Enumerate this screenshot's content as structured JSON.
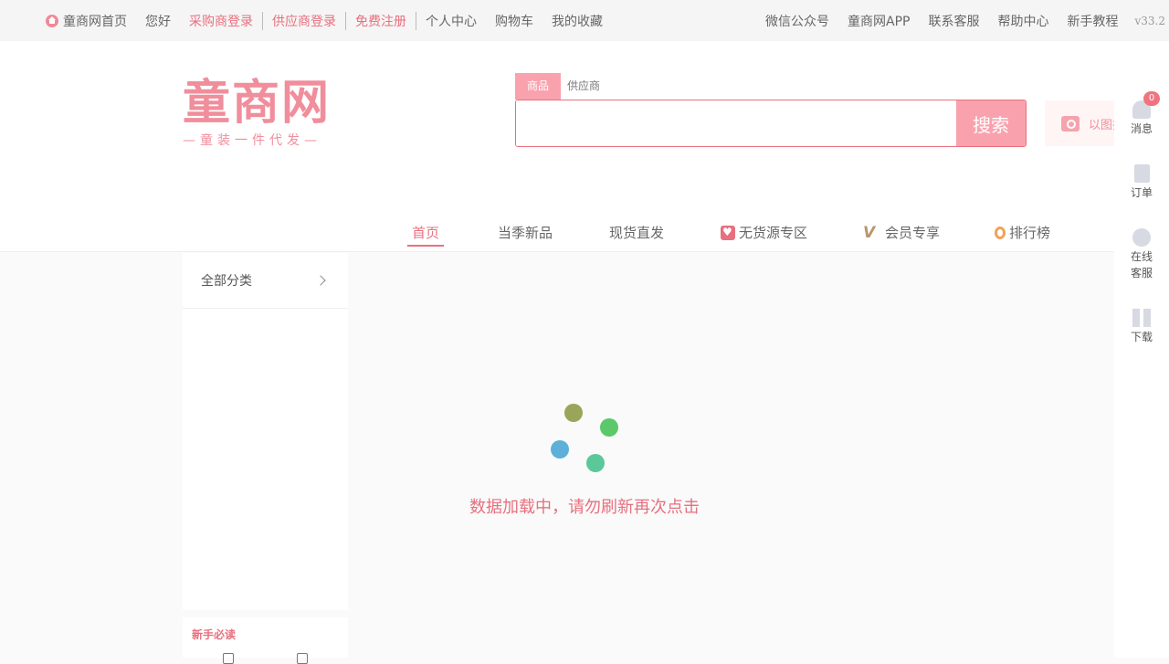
{
  "topbar": {
    "left": [
      {
        "label": "童商网首页",
        "style": "home"
      },
      {
        "label": "您好",
        "style": "plain"
      },
      {
        "label": "采购商登录",
        "style": "pink"
      },
      {
        "label": "供应商登录",
        "style": "pink"
      },
      {
        "label": "免费注册",
        "style": "pink"
      },
      {
        "label": "个人中心",
        "style": "plain"
      },
      {
        "label": "购物车",
        "style": "plain"
      },
      {
        "label": "我的收藏",
        "style": "plain"
      }
    ],
    "right": [
      "微信公众号",
      "童商网APP",
      "联系客服",
      "帮助中心",
      "新手教程"
    ],
    "version": "v33.2"
  },
  "logo": {
    "main": "童商网",
    "sub": "—童装一件代发—"
  },
  "search": {
    "tabs": [
      "商品",
      "供应商"
    ],
    "placeholder": "",
    "button_label": "搜索",
    "image_search_label": "以图搜"
  },
  "nav": {
    "items": [
      "首页",
      "当季新品",
      "现货直发",
      "无货源专区",
      "会员专享",
      "排行榜"
    ]
  },
  "category": {
    "header": "全部分类"
  },
  "newbie": {
    "title": "新手必读"
  },
  "loading": {
    "message": "数据加载中，请勿刷新再次点击",
    "dot_colors": [
      "#9aa55a",
      "#5bc86a",
      "#5eb0d8",
      "#5bc89a"
    ]
  },
  "right_bar": {
    "badge": "0",
    "items": [
      "消息",
      "订单",
      "在线客服",
      "下载"
    ]
  },
  "colors": {
    "accent": "#e8707e",
    "accent_light": "#f9a2ad"
  }
}
